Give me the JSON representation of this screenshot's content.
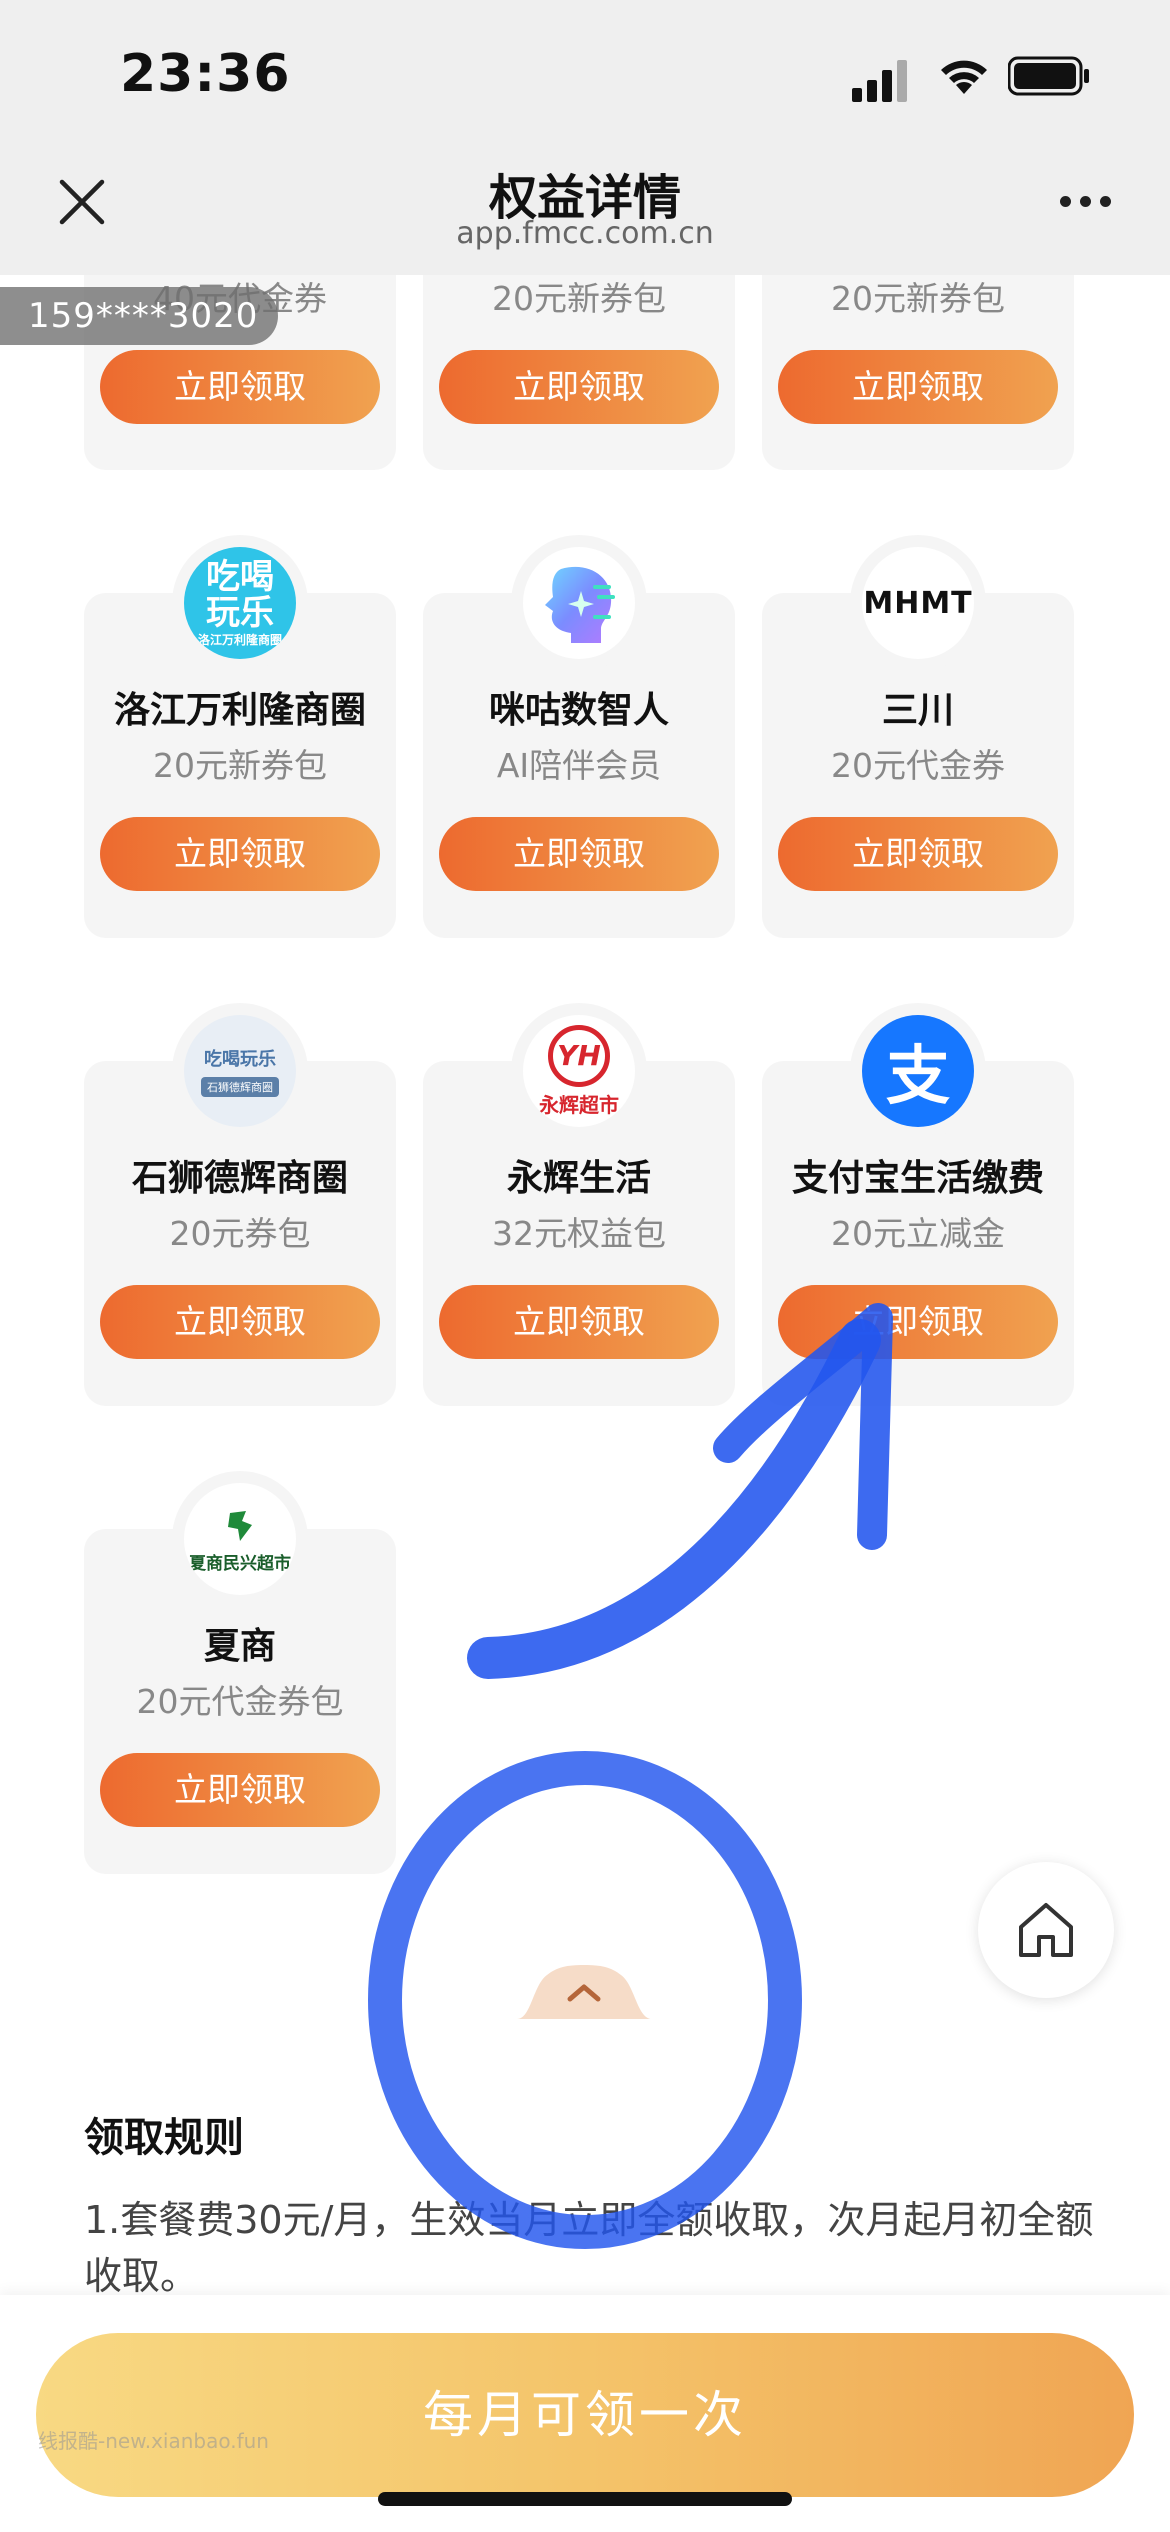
{
  "status_bar": {
    "time": "23:36"
  },
  "nav": {
    "title": "权益详情",
    "subtitle": "app.fmcc.com.cn"
  },
  "account_badge": "159****3020",
  "partial_cards": [
    {
      "desc": "40元代金券",
      "button": "立即领取"
    },
    {
      "desc": "20元新券包",
      "button": "立即领取"
    },
    {
      "desc": "20元新券包",
      "button": "立即领取"
    }
  ],
  "cards": [
    {
      "name": "洛江万利隆商圈",
      "desc": "20元新券包",
      "button": "立即领取",
      "logo": {
        "icon": "chihe-wanle-logo",
        "line1": "吃喝",
        "line2": "玩乐",
        "line3": "洛江万利隆商圈"
      }
    },
    {
      "name": "咪咕数智人",
      "desc": "AI陪伴会员",
      "button": "立即领取",
      "logo": {
        "icon": "migu-digital-human-logo"
      }
    },
    {
      "name": "三川",
      "desc": "20元代金券",
      "button": "立即领取",
      "logo": {
        "icon": "mhmt-logo",
        "text": "MHMT"
      }
    },
    {
      "name": "石狮德辉商圈",
      "desc": "20元券包",
      "button": "立即领取",
      "logo": {
        "icon": "shishi-dehui-logo",
        "text": "吃喝玩乐",
        "bar": "石狮德辉商圈"
      }
    },
    {
      "name": "永辉生活",
      "desc": "32元权益包",
      "button": "立即领取",
      "logo": {
        "icon": "yonghui-logo",
        "mark": "YH",
        "text": "永辉超市"
      }
    },
    {
      "name": "支付宝生活缴费",
      "desc": "20元立减金",
      "button": "立即领取",
      "logo": {
        "icon": "alipay-logo",
        "text": "支"
      }
    },
    {
      "name": "夏商",
      "desc": "20元代金券包",
      "button": "立即领取",
      "logo": {
        "icon": "xiashang-logo",
        "text": "夏商民兴超市"
      }
    }
  ],
  "rules": {
    "title": "领取规则",
    "text": "1.套餐费30元/月，生效当月立即全额收取，次月起月初全额收取。"
  },
  "bottom": {
    "button": "每月可领一次",
    "watermark": "线报酷-new.xianbao.fun"
  },
  "colors": {
    "claim_gradient": [
      "#ed6a2f",
      "#f0a250"
    ],
    "main_gradient": [
      "#f8d983",
      "#f0a553"
    ],
    "annotation_blue": "#2255ee"
  }
}
